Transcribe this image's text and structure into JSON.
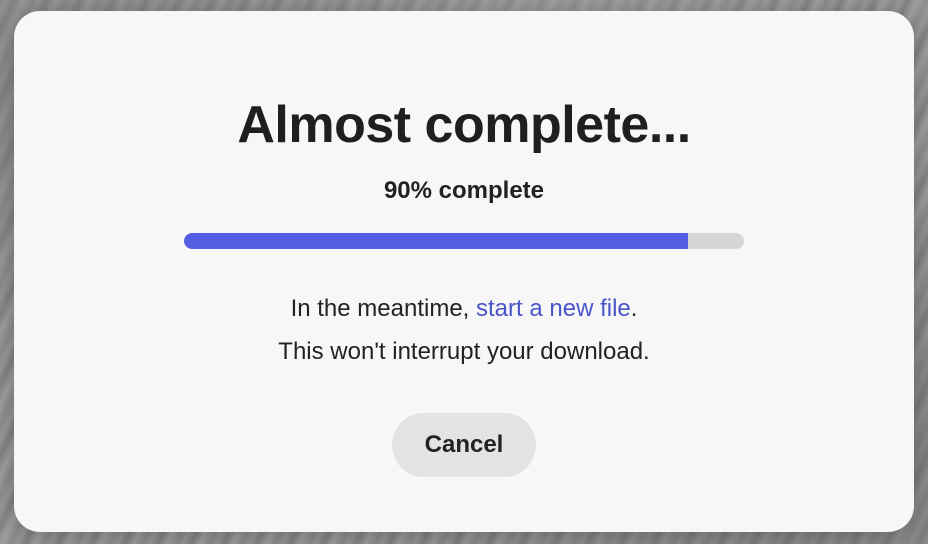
{
  "dialog": {
    "title": "Almost complete...",
    "progress": {
      "label": "90% complete",
      "percent": 90,
      "fill_color": "#545de2",
      "track_color": "#d6d6d6"
    },
    "message": {
      "line1_prefix": "In the meantime, ",
      "link_text": "start a new file",
      "line1_suffix": ".",
      "line2": "This won't interrupt your download.",
      "link_color": "#4a55c9"
    },
    "cancel_label": "Cancel"
  }
}
